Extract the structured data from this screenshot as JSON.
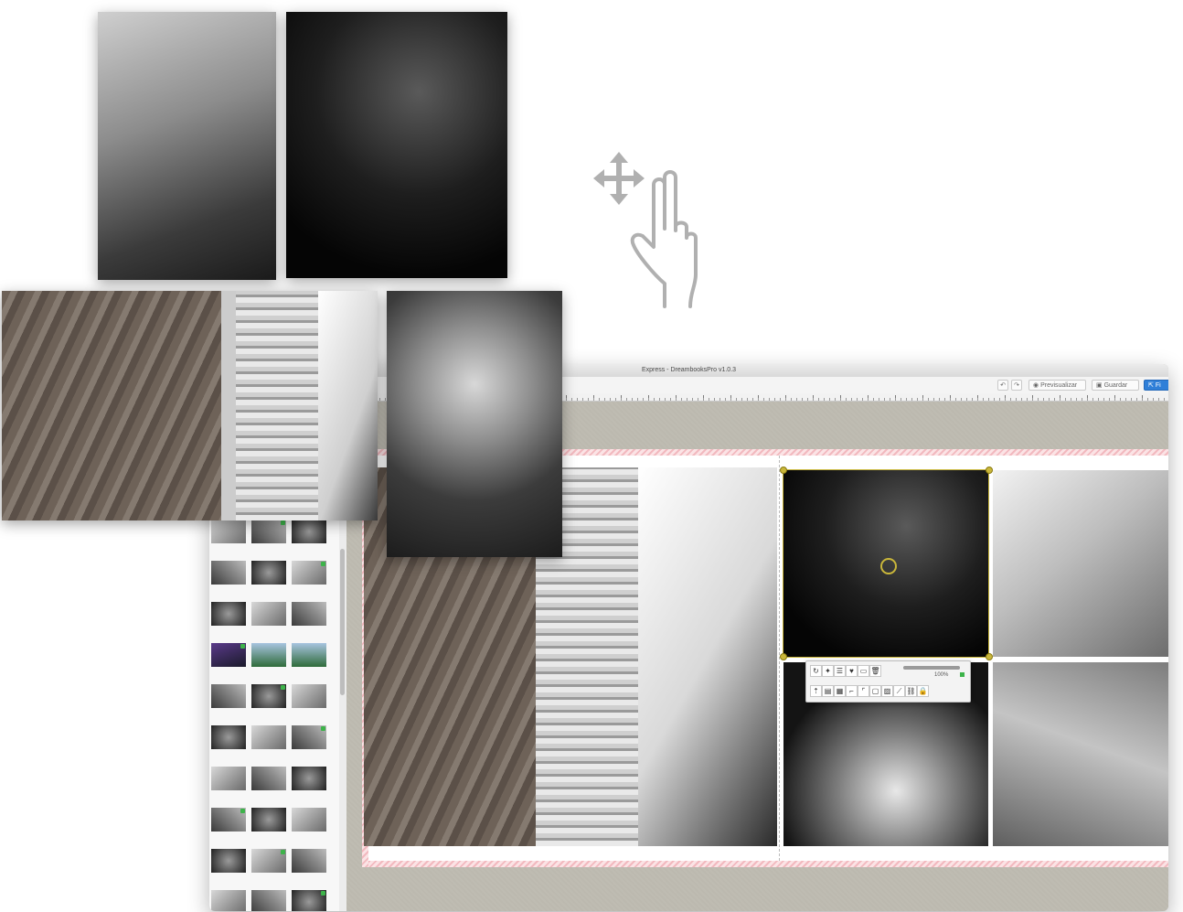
{
  "window": {
    "title": "Express - DreambooksPro v1.0.3"
  },
  "toolbar": {
    "undo_icon": "undo-icon",
    "redo_icon": "redo-icon",
    "preview_label": "Previsualizar",
    "save_label": "Guardar",
    "finish_label": "Fi"
  },
  "photo_toolbar": {
    "zoom_value": "100%",
    "zoom_fraction": 1.0,
    "icons": [
      "rotate-icon",
      "magic-wand-icon",
      "adjust-icon",
      "heart-icon",
      "image-icon",
      "trash-icon",
      "bring-front-icon",
      "arrange-icon",
      "group-icon",
      "frame-icon",
      "crop-icon",
      "border-icon",
      "filter-icon",
      "curve-icon",
      "link-icon",
      "lock-icon"
    ]
  },
  "sidebar": {
    "thumbnail_rows": 10,
    "thumbnail_cols": 3
  },
  "colors": {
    "accent": "#2f7fd8",
    "badge": "#3db34a",
    "bleed": "#f2b9bf",
    "handle": "#c9b63a"
  }
}
